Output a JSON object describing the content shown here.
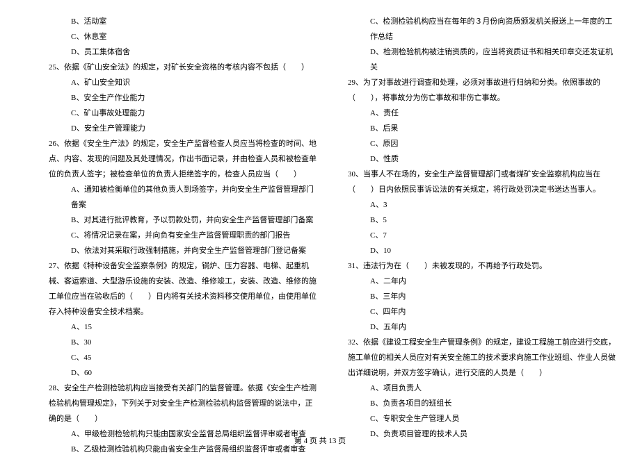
{
  "left": {
    "opt24b": "B、活动室",
    "opt24c": "C、休息室",
    "opt24d": "D、员工集体宿舍",
    "q25": "25、依据《矿山安全法》的规定，对矿长安全资格的考核内容不包括（　　）",
    "q25a": "A、矿山安全知识",
    "q25b": "B、安全生产作业能力",
    "q25c": "C、矿山事故处理能力",
    "q25d": "D、安全生产管理能力",
    "q26": "26、依据《安全生产法》的规定，安全生产监督检查人员应当将检查的时间、地点、内容、发现的问题及其处理情况，作出书面记录，并由检查人员和被检查单位的负责人签字；被检查单位的负责人拒绝签字的，检查人员应当（　　）",
    "q26a": "A、通知被检衡单位的其他负责人到场签字，并向安全生产监督管理部门备案",
    "q26b": "B、对其进行批评教育，予以罚款处罚，并向安全生产监督管理部门备案",
    "q26c": "C、将情况记录在案，并向负有安全生产监督管理职责的部门报告",
    "q26d": "D、依法对其采取行政强制措施，并向安全生产监督管理部门登记备案",
    "q27": "27、依据《特种设备安全监察条例》的规定，锅炉、压力容器、电梯、起重机械、客运索道、大型游乐设施的安装、改造、维修竣工，安装、改造、维修的施工单位应当在验收后的（　　）日内将有关技术资料移交使用单位，由使用单位存入特种设备安全技术档案。",
    "q27a": "A、15",
    "q27b": "B、30",
    "q27c": "C、45",
    "q27d": "D、60",
    "q28": "28、安全生产检测检验机构应当接受有关部门的监督管理。依据《安全生产检测检验机构管理规定》，下列关于对安全生产检测检验机构监督管理的说法中，正确的是（　　）",
    "q28a": "A、甲级检测检验机构只能由国家安全监督总局组织监督评审或者审查",
    "q28b": "B、乙级检测检验机构只能由省安全生产监督局组织监督评审或者审查"
  },
  "right": {
    "q28c": "C、检测检验机构应当在每年的３月份向资质颁发机关报送上一年度的工作总结",
    "q28d": "D、检测检验机构被注销资质的，应当将资质证书和相关印章交还发证机关",
    "q29": "29、为了对事故进行调查和处理，必须对事故进行归纳和分类。依照事故的（　　），将事故分为伤亡事故和非伤亡事故。",
    "q29a": "A、责任",
    "q29b": "B、后果",
    "q29c": "C、原因",
    "q29d": "D、性质",
    "q30": "30、当事人不在场的，安全生产监督管理部门或者煤矿安全监察机构应当在（　　）日内依照民事诉讼法的有关规定，将行政处罚决定书送达当事人。",
    "q30a": "A、3",
    "q30b": "B、5",
    "q30c": "C、7",
    "q30d": "D、10",
    "q31": "31、违法行为在（　　）未被发现的，不再给予行政处罚。",
    "q31a": "A、二年内",
    "q31b": "B、三年内",
    "q31c": "C、四年内",
    "q31d": "D、五年内",
    "q32": "32、依据《建设工程安全生产管理条例》的规定，建设工程施工前应进行交底，施工单位的相关人员应对有关安全施工的技术要求向施工作业班组、作业人员做出详细说明，并双方签字确认，进行交底的人员是（　　）",
    "q32a": "A、项目负责人",
    "q32b": "B、负责各项目的班组长",
    "q32c": "C、专职安全生产管理人员",
    "q32d": "D、负责项目管理的技术人员"
  },
  "footer": "第 4 页 共 13 页"
}
